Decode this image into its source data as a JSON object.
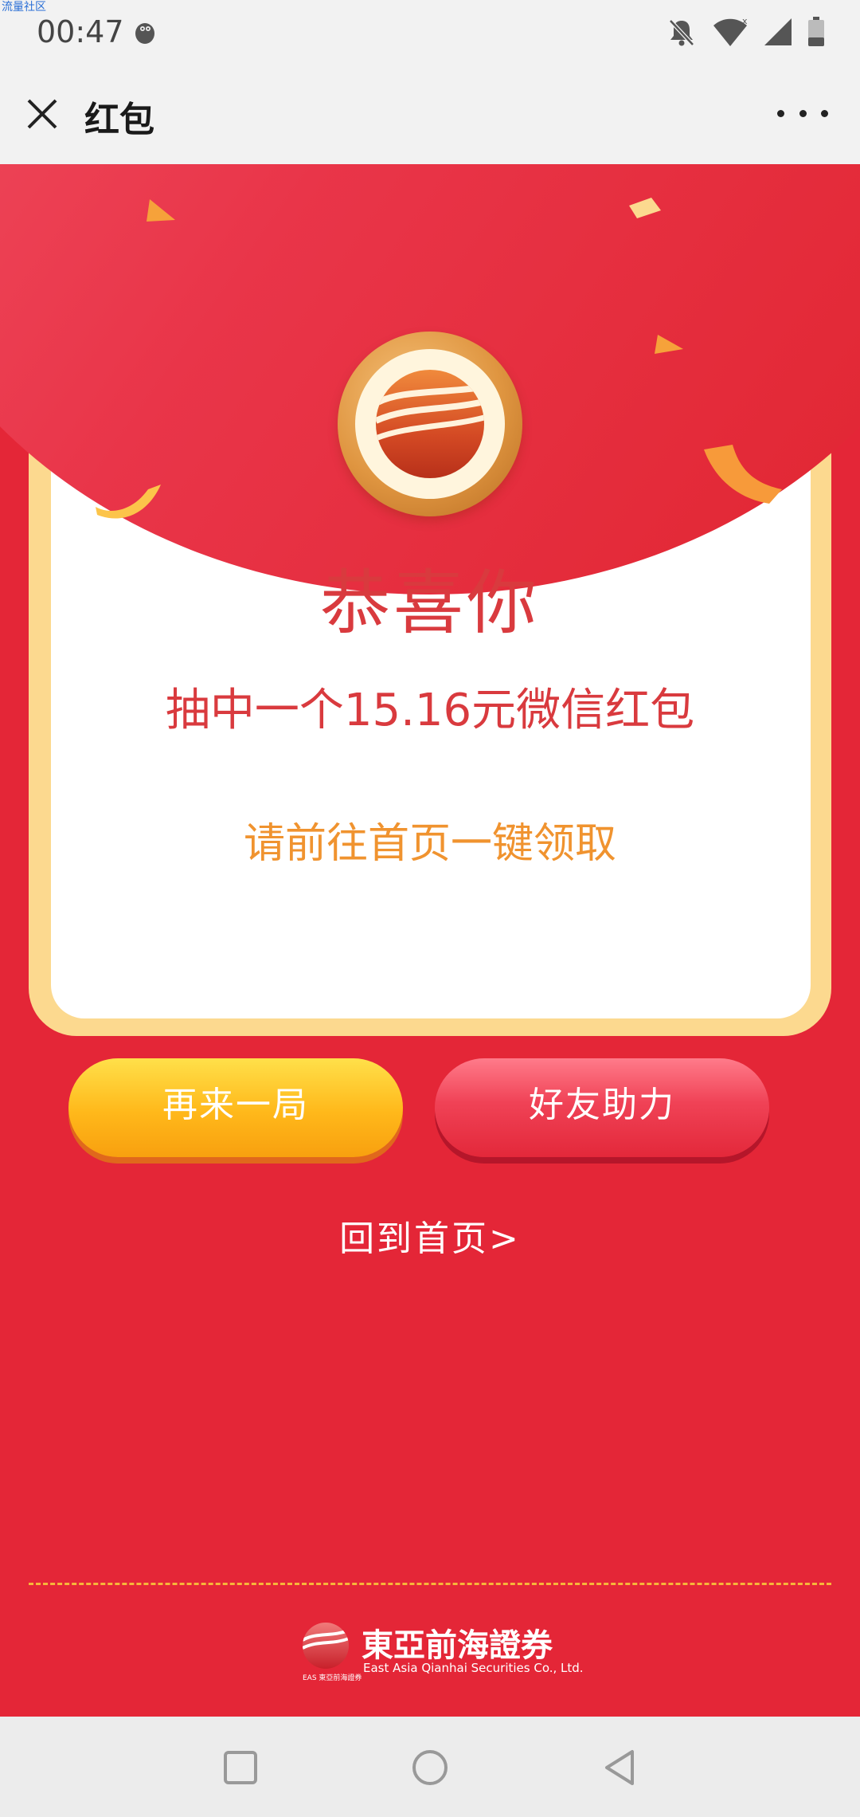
{
  "watermark": "流量社区",
  "status_bar": {
    "time": "00:47",
    "icons": [
      "app-notification-icon",
      "mute-bell-icon",
      "wifi-icon",
      "signal-icon",
      "battery-icon"
    ]
  },
  "nav": {
    "title": "红包",
    "close_icon": "close-icon",
    "more_icon": "more-icon"
  },
  "result": {
    "headline": "恭喜你",
    "prize": "抽中一个15.16元微信红包",
    "instruction": "请前往首页一键领取"
  },
  "buttons": {
    "retry": "再来一局",
    "help": "好友助力"
  },
  "home_link": "回到首页>",
  "brand": {
    "small": "EAS 東亞前海證券",
    "name_cn": "東亞前海證券",
    "name_en": "East Asia Qianhai Securities Co., Ltd."
  },
  "system_nav": [
    "square-recent-icon",
    "circle-home-icon",
    "triangle-back-icon"
  ],
  "colors": {
    "background": "#e42637",
    "card_border": "#fcd98f",
    "headline": "#d93a3e",
    "instruction": "#f0932f",
    "retry_button": "#ffb81a",
    "help_button": "#f04256"
  }
}
